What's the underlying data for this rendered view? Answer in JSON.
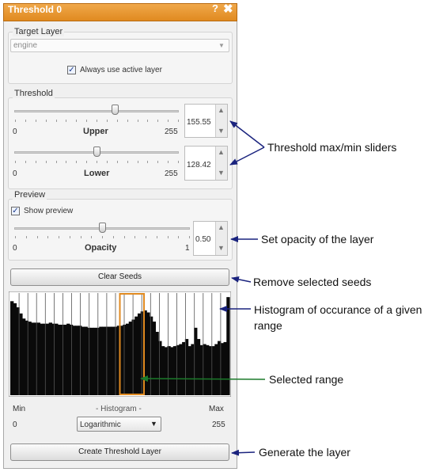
{
  "window": {
    "title": "Threshold 0",
    "help_glyph": "?",
    "close_glyph": "✖"
  },
  "target_layer": {
    "group_label": "Target Layer",
    "selected_value": "engine",
    "always_active_label": "Always use active layer",
    "always_active_checked": true
  },
  "threshold": {
    "group_label": "Threshold",
    "upper": {
      "label": "Upper",
      "min_label": "0",
      "max_label": "255",
      "value": "155.55",
      "level": 0.61
    },
    "lower": {
      "label": "Lower",
      "min_label": "0",
      "max_label": "255",
      "value": "128.42",
      "level": 0.5
    }
  },
  "preview": {
    "group_label": "Preview",
    "show_preview_label": "Show preview",
    "show_preview_checked": true,
    "opacity": {
      "label": "Opacity",
      "min_label": "0",
      "max_label": "1",
      "value": "0.50",
      "level": 0.5
    }
  },
  "clear_seeds_label": "Clear Seeds",
  "histogram": {
    "min_label": "Min",
    "title": "- Histogram -",
    "max_label": "Max",
    "min_value": "0",
    "max_value": "255",
    "scale_selected": "Logarithmic",
    "selected_range_start": 0.5,
    "selected_range_end": 0.61,
    "profile": [
      0.92,
      0.9,
      0.86,
      0.8,
      0.75,
      0.73,
      0.72,
      0.71,
      0.71,
      0.71,
      0.7,
      0.7,
      0.7,
      0.71,
      0.7,
      0.7,
      0.69,
      0.69,
      0.69,
      0.7,
      0.69,
      0.68,
      0.68,
      0.68,
      0.67,
      0.67,
      0.66,
      0.66,
      0.66,
      0.66,
      0.67,
      0.67,
      0.67,
      0.67,
      0.67,
      0.67,
      0.68,
      0.68,
      0.69,
      0.7,
      0.72,
      0.74,
      0.77,
      0.8,
      0.82,
      0.83,
      0.81,
      0.77,
      0.72,
      0.62,
      0.53,
      0.48,
      0.47,
      0.48,
      0.47,
      0.48,
      0.49,
      0.5,
      0.52,
      0.55,
      0.48,
      0.5,
      0.66,
      0.55,
      0.49,
      0.5,
      0.49,
      0.48,
      0.48,
      0.5,
      0.53,
      0.51,
      0.52,
      0.96
    ]
  },
  "create_layer_label": "Create Threshold Layer",
  "annotations": {
    "sliders": "Threshold max/min sliders",
    "opacity": "Set opacity of the layer",
    "seeds": "Remove selected seeds",
    "histogram_line1": "Histogram of occurance of a given",
    "histogram_line2": "range",
    "range": "Selected range",
    "generate": "Generate the layer"
  },
  "colors": {
    "title_bar": "#e8962e",
    "range_marker": "#e08a20",
    "arrow_blue": "#1a237e",
    "arrow_green": "#1b7a2a"
  }
}
